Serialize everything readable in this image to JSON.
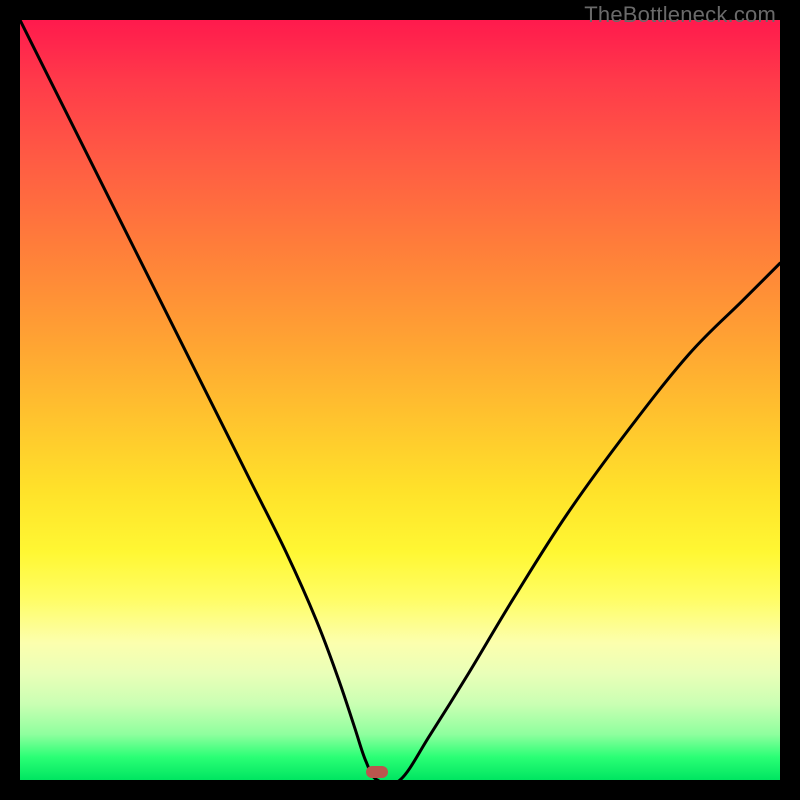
{
  "watermark": "TheBottleneck.com",
  "chart_data": {
    "type": "line",
    "title": "",
    "xlabel": "",
    "ylabel": "",
    "xlim": [
      0,
      100
    ],
    "ylim": [
      0,
      100
    ],
    "grid": false,
    "series": [
      {
        "name": "bottleneck-curve",
        "x": [
          0,
          6,
          12,
          18,
          24,
          30,
          35,
          39,
          42,
          44,
          45.5,
          47,
          50,
          54,
          59,
          65,
          72,
          80,
          88,
          95,
          100
        ],
        "values": [
          100,
          88,
          76,
          64,
          52,
          40,
          30,
          21,
          13,
          7,
          2.5,
          0,
          0,
          6,
          14,
          24,
          35,
          46,
          56,
          63,
          68
        ]
      }
    ],
    "marker": {
      "x": 47,
      "y": 1
    },
    "background_gradient": {
      "top": "#ff1a4d",
      "mid": "#ffe22a",
      "bottom": "#00e561"
    },
    "colors": {
      "curve": "#000000",
      "marker": "#b9564e"
    }
  }
}
